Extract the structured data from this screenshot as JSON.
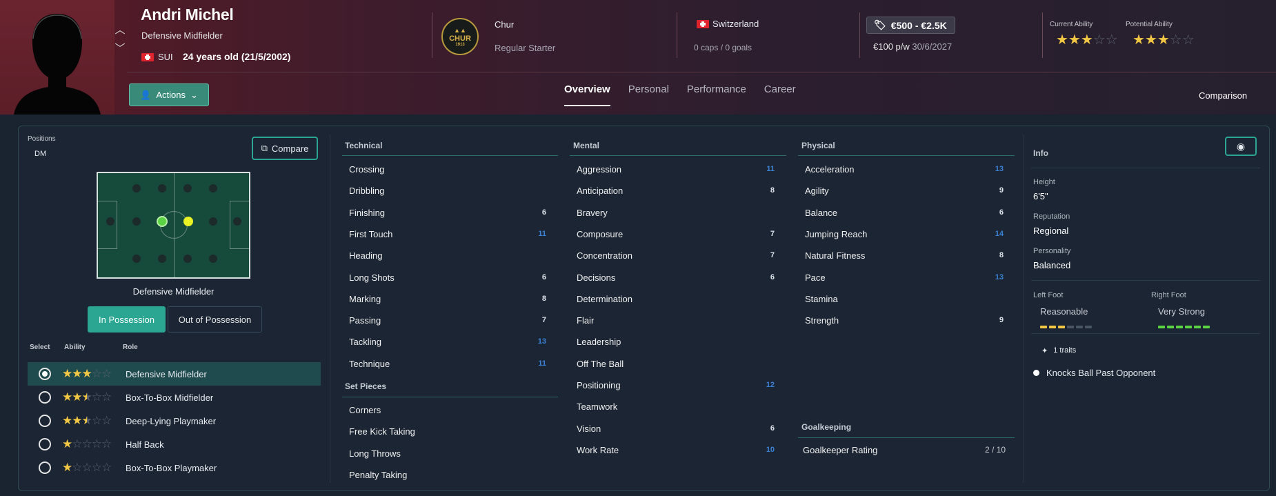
{
  "player": {
    "name": "Andri Michel",
    "position": "Defensive Midfielder",
    "nationality_code": "SUI",
    "age": "24 years old (21/5/2002)"
  },
  "club": {
    "name": "Chur",
    "status": "Regular Starter",
    "logo_text": "CHUR",
    "logo_year": "1913"
  },
  "nation": {
    "name": "Switzerland",
    "caps": "0 caps / 0 goals"
  },
  "contract": {
    "value": "€500 - €2.5K",
    "wage": "€100 p/w",
    "expiry": "30/6/2027"
  },
  "ability": {
    "current_label": "Current Ability",
    "potential_label": "Potential Ability",
    "current_stars": 3,
    "potential_stars": 3
  },
  "actions_label": "Actions",
  "tabs": [
    "Overview",
    "Personal",
    "Performance",
    "Career"
  ],
  "comparison_label": "Comparison",
  "positions": {
    "label": "Positions",
    "value": "DM",
    "compare_label": "Compare",
    "pitch_caption": "Defensive Midfielder",
    "in_possession": "In Possession",
    "out_possession": "Out of Possession"
  },
  "roles": {
    "headers": {
      "select": "Select",
      "ability": "Ability",
      "role": "Role"
    },
    "items": [
      {
        "name": "Defensive Midfielder",
        "stars": 3,
        "selected": true
      },
      {
        "name": "Box-To-Box Midfielder",
        "stars": 2.5,
        "selected": false
      },
      {
        "name": "Deep-Lying Playmaker",
        "stars": 2.5,
        "selected": false
      },
      {
        "name": "Half Back",
        "stars": 1,
        "selected": false
      },
      {
        "name": "Box-To-Box Playmaker",
        "stars": 1,
        "selected": false
      }
    ]
  },
  "technical": {
    "title": "Technical",
    "items": [
      {
        "name": "Crossing",
        "value": ""
      },
      {
        "name": "Dribbling",
        "value": ""
      },
      {
        "name": "Finishing",
        "value": "6"
      },
      {
        "name": "First Touch",
        "value": "11"
      },
      {
        "name": "Heading",
        "value": ""
      },
      {
        "name": "Long Shots",
        "value": "6"
      },
      {
        "name": "Marking",
        "value": "8"
      },
      {
        "name": "Passing",
        "value": "7"
      },
      {
        "name": "Tackling",
        "value": "13"
      },
      {
        "name": "Technique",
        "value": "11"
      }
    ]
  },
  "set_pieces": {
    "title": "Set Pieces",
    "items": [
      {
        "name": "Corners",
        "value": ""
      },
      {
        "name": "Free Kick Taking",
        "value": ""
      },
      {
        "name": "Long Throws",
        "value": ""
      },
      {
        "name": "Penalty Taking",
        "value": ""
      }
    ]
  },
  "mental": {
    "title": "Mental",
    "items": [
      {
        "name": "Aggression",
        "value": "11"
      },
      {
        "name": "Anticipation",
        "value": "8"
      },
      {
        "name": "Bravery",
        "value": ""
      },
      {
        "name": "Composure",
        "value": "7"
      },
      {
        "name": "Concentration",
        "value": "7"
      },
      {
        "name": "Decisions",
        "value": "6"
      },
      {
        "name": "Determination",
        "value": ""
      },
      {
        "name": "Flair",
        "value": ""
      },
      {
        "name": "Leadership",
        "value": ""
      },
      {
        "name": "Off The Ball",
        "value": ""
      },
      {
        "name": "Positioning",
        "value": "12"
      },
      {
        "name": "Teamwork",
        "value": ""
      },
      {
        "name": "Vision",
        "value": "6"
      },
      {
        "name": "Work Rate",
        "value": "10"
      }
    ]
  },
  "physical": {
    "title": "Physical",
    "items": [
      {
        "name": "Acceleration",
        "value": "13"
      },
      {
        "name": "Agility",
        "value": "9"
      },
      {
        "name": "Balance",
        "value": "6"
      },
      {
        "name": "Jumping Reach",
        "value": "14"
      },
      {
        "name": "Natural Fitness",
        "value": "8"
      },
      {
        "name": "Pace",
        "value": "13"
      },
      {
        "name": "Stamina",
        "value": ""
      },
      {
        "name": "Strength",
        "value": "9"
      }
    ]
  },
  "goalkeeping": {
    "title": "Goalkeeping",
    "rating_label": "Goalkeeper Rating",
    "rating_value": "2 / 10"
  },
  "info": {
    "title": "Info",
    "height_label": "Height",
    "height": "6'5\"",
    "reputation_label": "Reputation",
    "reputation": "Regional",
    "personality_label": "Personality",
    "personality": "Balanced",
    "left_foot_label": "Left Foot",
    "left_foot": "Reasonable",
    "left_foot_level": 3,
    "right_foot_label": "Right Foot",
    "right_foot": "Very Strong",
    "right_foot_level": 6,
    "traits_label": "1 traits",
    "trait": "Knocks Ball Past Opponent"
  },
  "colors": {
    "accent": "#2ba692",
    "star": "#f2c744",
    "attr_blue": "#3b82d6"
  }
}
